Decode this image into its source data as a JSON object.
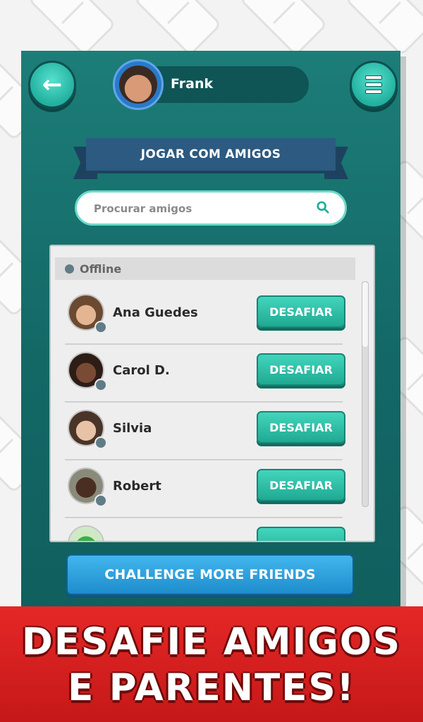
{
  "header": {
    "back_icon": "arrow-left-icon",
    "menu_icon": "hamburger-menu-icon",
    "player_name": "Frank"
  },
  "title": "JOGAR COM AMIGOS",
  "search": {
    "placeholder": "Procurar amigos",
    "icon": "search-icon"
  },
  "friends": {
    "section": "Offline",
    "items": [
      {
        "name": "Ana Guedes",
        "action": "DESAFIAR"
      },
      {
        "name": "Carol D.",
        "action": "DESAFIAR"
      },
      {
        "name": "Silvia",
        "action": "DESAFIAR"
      },
      {
        "name": "Robert",
        "action": "DESAFIAR"
      },
      {
        "name": "",
        "action": ""
      }
    ]
  },
  "more_button": "CHALLENGE MORE FRIENDS",
  "banner": {
    "line1": "DESAFIE AMIGOS",
    "line2": "E PARENTES!"
  },
  "colors": {
    "panel": "#136866",
    "accent": "#22b09f",
    "banner": "#d41f1f",
    "more_button": "#1d8dcc"
  }
}
